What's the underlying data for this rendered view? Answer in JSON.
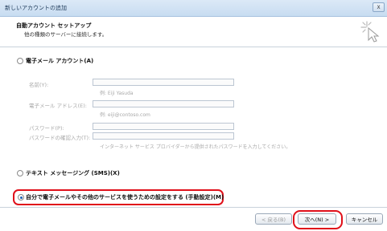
{
  "window": {
    "title": "新しいアカウントの追加",
    "close_label": "X"
  },
  "header": {
    "heading": "自動アカウント セットアップ",
    "subheading": "他の種類のサーバーに接続します。",
    "icon": "wizard-cursor-icon"
  },
  "email_option": {
    "label": "電子メール アカウント(A)",
    "fields": [
      {
        "label": "名前(Y):",
        "value": "",
        "hint": "例: Eiji Yasuda"
      },
      {
        "label": "電子メール アドレス(E):",
        "value": "",
        "hint": "例: eiji@contoso.com"
      },
      {
        "label": "パスワード(P):",
        "value": "",
        "hint": ""
      },
      {
        "label": "パスワードの確認入力(T):",
        "value": "",
        "hint": "インターネット サービス プロバイダーから提供されたパスワードを入力してください。"
      }
    ]
  },
  "sms_option": {
    "label": "テキスト メッセージング (SMS)(X)"
  },
  "manual_option": {
    "label": "自分で電子メールやその他のサービスを使うための設定をする (手動設定)(M)",
    "selected": true
  },
  "buttons": {
    "back": "< 戻る(B)",
    "next": "次へ(N) >",
    "cancel": "キャンセル"
  },
  "highlight_color": "#e0101a"
}
